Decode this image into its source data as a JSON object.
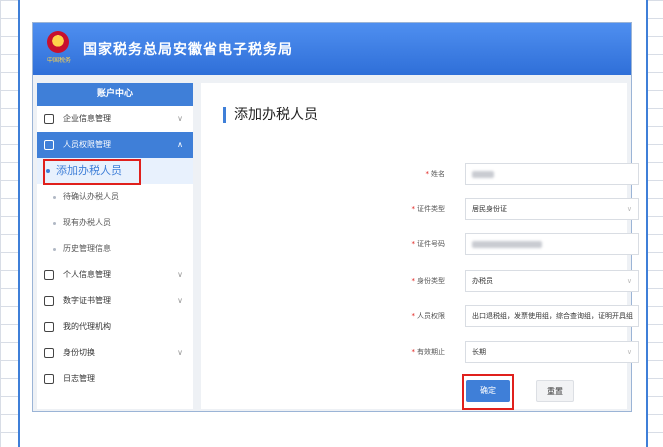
{
  "header": {
    "title": "国家税务总局安徽省电子税务局",
    "emblem_caption": "中国税务"
  },
  "sidebar": {
    "header": "账户中心",
    "items": [
      {
        "label": "企业信息管理",
        "icon": "building-icon",
        "chevron": "∨"
      },
      {
        "label": "人员权限管理",
        "icon": "person-lock-icon",
        "chevron": "∧"
      },
      {
        "label": "个人信息管理",
        "icon": "id-card-icon",
        "chevron": "∨"
      },
      {
        "label": "数字证书管理",
        "icon": "certificate-icon",
        "chevron": "∨"
      },
      {
        "label": "我的代理机构",
        "icon": "agency-icon"
      },
      {
        "label": "身份切换",
        "icon": "switch-icon",
        "chevron": "∨"
      },
      {
        "label": "日志管理",
        "icon": "log-icon"
      }
    ],
    "sub_items": [
      {
        "label": "添加办税人员"
      },
      {
        "label": "待确认办税人员"
      },
      {
        "label": "现有办税人员"
      },
      {
        "label": "历史管理信息"
      }
    ]
  },
  "content": {
    "title": "添加办税人员",
    "form": {
      "name_label": "姓名",
      "id_type_label": "证件类型",
      "id_type_value": "居民身份证",
      "id_number_label": "证件号码",
      "identity_type_label": "身份类型",
      "identity_type_value": "办税员",
      "permissions_label": "人员权限",
      "permissions_value": "出口退税组，发票使用组，综合查询组，证明开具组",
      "validity_label": "有效期止",
      "validity_value": "长期",
      "required_mark": "*"
    },
    "confirm_label": "确定",
    "reset_label": "重置"
  },
  "colors": {
    "brand_blue": "#3f7fd8",
    "annotation_red": "#e0201c"
  }
}
